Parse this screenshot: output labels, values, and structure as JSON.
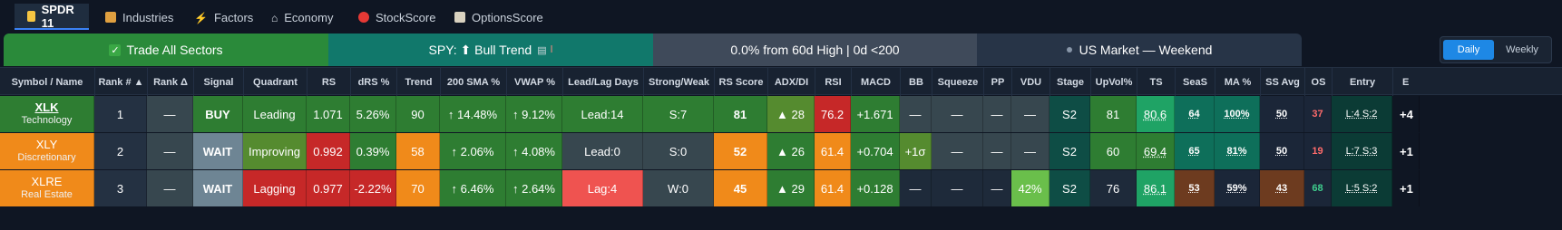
{
  "tabs": [
    {
      "label": "SPDR 11",
      "icon": "bar-chart-icon",
      "active": true
    },
    {
      "label": "Industries",
      "icon": "factory-icon"
    },
    {
      "label": "Factors",
      "icon": "lightning-icon"
    },
    {
      "label": "Economy",
      "icon": "bank-icon"
    },
    {
      "label": "StockScore",
      "icon": "target-icon"
    },
    {
      "label": "OptionsScore",
      "icon": "clipboard-icon"
    }
  ],
  "banners": {
    "sectors": "Trade All Sectors",
    "spy": "SPY: ⬆ Bull Trend",
    "high": "0.0% from 60d High | 0d <200",
    "market": "US Market — Weekend"
  },
  "timeframe": {
    "daily": "Daily",
    "weekly": "Weekly",
    "selected": "Daily"
  },
  "columns": [
    "Symbol / Name",
    "Rank # ▲",
    "Rank Δ",
    "Signal",
    "Quadrant",
    "RS",
    "dRS %",
    "Trend",
    "200 SMA %",
    "VWAP %",
    "Lead/Lag Days",
    "Strong/Weak",
    "RS Score",
    "ADX/DI",
    "RSI",
    "MACD",
    "BB",
    "Squeeze",
    "PP",
    "VDU",
    "Stage",
    "UpVol%",
    "TS",
    "SeaS",
    "MA %",
    "SS Avg",
    "OS",
    "Entry",
    "E"
  ],
  "rows": [
    {
      "symbol": "XLK",
      "name": "Technology",
      "rank": "1",
      "rank_delta": "—",
      "signal": "BUY",
      "quadrant": "Leading",
      "rs": "1.071",
      "drs": "5.26%",
      "trend": "90",
      "sma200": "↑ 14.48%",
      "vwap": "↑ 9.12%",
      "leadlag": "Lead:14",
      "strongweak": "S:7",
      "rsscore": "81",
      "adx": "▲ 28",
      "rsi": "76.2",
      "macd": "+1.671",
      "bb": "—",
      "squeeze": "—",
      "pp": "—",
      "vdu": "—",
      "stage": "S2",
      "upvol": "81",
      "ts": "80.6",
      "seas": "64",
      "ma": "100%",
      "ssavg": "50",
      "os": "37",
      "entry": "L:4 S:2",
      "e": "+4"
    },
    {
      "symbol": "XLY",
      "name": "Discretionary",
      "rank": "2",
      "rank_delta": "—",
      "signal": "WAIT",
      "quadrant": "Improving",
      "rs": "0.992",
      "drs": "0.39%",
      "trend": "58",
      "sma200": "↑ 2.06%",
      "vwap": "↑ 4.08%",
      "leadlag": "Lead:0",
      "strongweak": "S:0",
      "rsscore": "52",
      "adx": "▲ 26",
      "rsi": "61.4",
      "macd": "+0.704",
      "bb": "+1σ",
      "squeeze": "—",
      "pp": "—",
      "vdu": "—",
      "stage": "S2",
      "upvol": "60",
      "ts": "69.4",
      "seas": "65",
      "ma": "81%",
      "ssavg": "50",
      "os": "19",
      "entry": "L:7 S:3",
      "e": "+1"
    },
    {
      "symbol": "XLRE",
      "name": "Real Estate",
      "rank": "3",
      "rank_delta": "—",
      "signal": "WAIT",
      "quadrant": "Lagging",
      "rs": "0.977",
      "drs": "-2.22%",
      "trend": "70",
      "sma200": "↑ 6.46%",
      "vwap": "↑ 2.64%",
      "leadlag": "Lag:4",
      "strongweak": "W:0",
      "rsscore": "45",
      "adx": "▲ 29",
      "rsi": "61.4",
      "macd": "+0.128",
      "bb": "—",
      "squeeze": "—",
      "pp": "—",
      "vdu": "42%",
      "stage": "S2",
      "upvol": "76",
      "ts": "86.1",
      "seas": "53",
      "ma": "59%",
      "ssavg": "43",
      "os": "68",
      "entry": "L:5 S:2",
      "e": "+1"
    }
  ],
  "colors": {
    "green": "#2e7d32",
    "orange": "#f08a1a",
    "red": "#c62828",
    "slate": "#37474f",
    "teal": "#0e6f66",
    "dark_teal": "#0b3b35",
    "bright_green": "#1fa365",
    "blue": "#1976d2"
  }
}
